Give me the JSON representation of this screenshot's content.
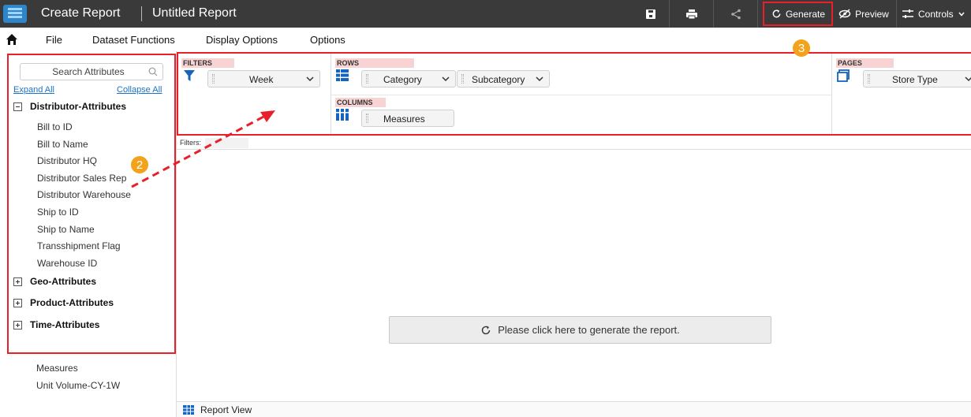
{
  "header": {
    "app_title": "Create Report",
    "report_name": "Untitled Report",
    "generate_label": "Generate",
    "preview_label": "Preview",
    "controls_label": "Controls"
  },
  "menu": {
    "items": [
      "File",
      "Dataset Functions",
      "Display Options",
      "Options"
    ]
  },
  "sidebar": {
    "search_placeholder": "Search Attributes",
    "expand_all": "Expand All",
    "collapse_all": "Collapse All",
    "groups": [
      {
        "label": "Distributor-Attributes",
        "expanded": true,
        "items": [
          "Bill to ID",
          "Bill to Name",
          "Distributor HQ",
          "Distributor Sales Rep",
          "Distributor Warehouse",
          "Ship to ID",
          "Ship to Name",
          "Transshipment Flag",
          "Warehouse ID"
        ]
      },
      {
        "label": "Geo-Attributes",
        "expanded": false
      },
      {
        "label": "Product-Attributes",
        "expanded": false
      },
      {
        "label": "Time-Attributes",
        "expanded": false
      }
    ],
    "measures_label": "Measures",
    "measures_items": [
      "Unit Volume-CY-1W"
    ]
  },
  "pivot": {
    "filters_label": "FILTERS",
    "filters_value": "Week",
    "rows_label": "ROWS",
    "rows_values": [
      "Category",
      "Subcategory"
    ],
    "columns_label": "COLUMNS",
    "columns_value": "Measures",
    "pages_label": "PAGES",
    "pages_value": "Store Type"
  },
  "filters_bar_label": "Filters:",
  "main": {
    "generate_message": "Please click here to generate the report."
  },
  "bottom": {
    "tab_label": "Report View"
  },
  "annotations": {
    "step_2": "2",
    "step_3": "3"
  },
  "colors": {
    "topbar": "#3a3a3a",
    "highlight": "#e8202a",
    "badge": "#f2a21b",
    "link": "#1a73c9",
    "icon_blue": "#1565c0"
  }
}
